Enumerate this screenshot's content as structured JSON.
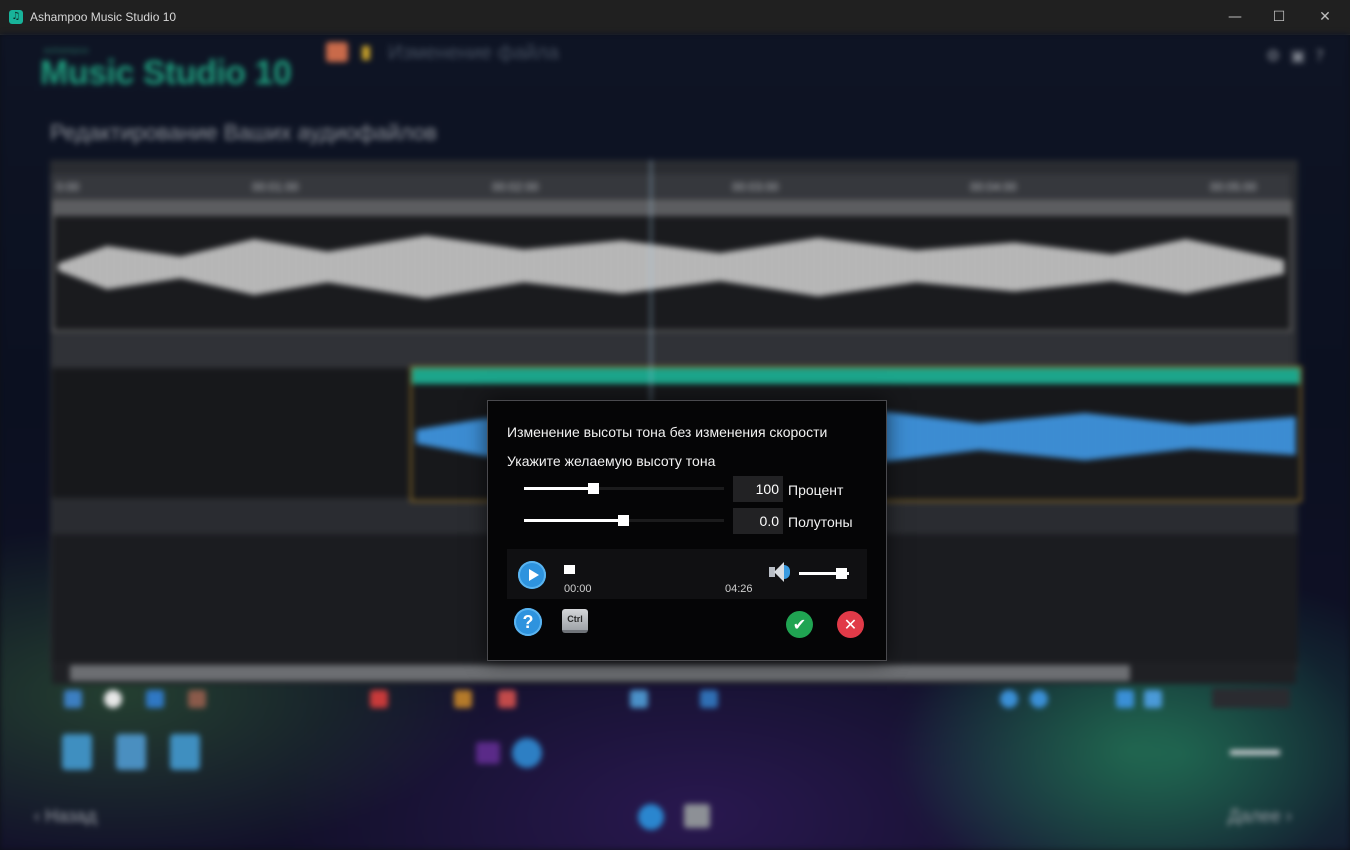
{
  "window": {
    "title": "Ashampoo Music Studio 10",
    "minimize_glyph": "—",
    "maximize_glyph": "☐",
    "close_glyph": "✕",
    "app_icon_glyph": "♫"
  },
  "background": {
    "logo_small": "ashampoo",
    "logo": "Music Studio 10",
    "breadcrumb": "Изменение файла",
    "heading": "Редактирование Ваших аудиофайлов",
    "ruler_ticks": [
      "0:00",
      "00:01:00",
      "00:02:00",
      "00:03:00",
      "00:04:00",
      "00:05:00"
    ],
    "nav_back": "Назад",
    "nav_next": "Далее"
  },
  "dialog": {
    "title": "Изменение высоты тона без изменения скорости",
    "subtitle": "Укажите желаемую высоту тона",
    "percent": {
      "value": "100",
      "label": "Процент",
      "slider_fraction": 0.35
    },
    "semitones": {
      "value": "0.0",
      "label": "Полутоны",
      "slider_fraction": 0.5
    },
    "player": {
      "time_start": "00:00",
      "time_end": "04:26",
      "position_fraction": 0.0,
      "volume_fraction": 0.85
    },
    "help_glyph": "?",
    "ctrl_label": "Ctrl",
    "ok_glyph": "✔",
    "cancel_glyph": "✕"
  },
  "colors": {
    "accent_blue": "#2e93de",
    "ok_green": "#20a452",
    "cancel_red": "#e13a48",
    "brand_teal": "#1ca58b"
  }
}
